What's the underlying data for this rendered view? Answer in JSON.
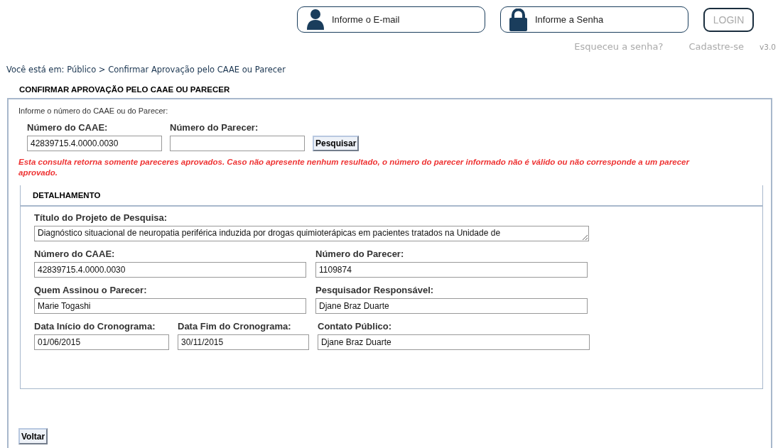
{
  "header": {
    "email": {
      "placeholder": "Informe o E-mail"
    },
    "password": {
      "placeholder": "Informe a Senha"
    },
    "login_button": "LOGIN",
    "links": [
      "Esqueceu a senha?",
      "Cadastre-se"
    ],
    "version": "v3.0"
  },
  "breadcrumb": "Você está em: Público > Confirmar Aprovação pelo CAAE ou Parecer",
  "section_title": "CONFIRMAR APROVAÇÃO PELO CAAE OU PARECER",
  "search": {
    "instruction": "Informe o número do CAAE ou do Parecer:",
    "fields": [
      {
        "label": "Número do CAAE:",
        "value": "42839715.4.0000.0030"
      },
      {
        "label": "Número do Parecer:"
      }
    ],
    "button": "Pesquisar",
    "warning": "Esta consulta retorna somente pareceres aprovados. Caso não apresente nenhum resultado, o número do parecer informado não é válido ou não corresponde a um parecer aprovado."
  },
  "detail": {
    "title": "DETALHAMENTO",
    "rows": [
      {
        "kind": "single",
        "fields": [
          {
            "kind": "textarea",
            "label": "Título do Projeto de Pesquisa:",
            "value": "Diagnóstico situacional de neuropatia periférica induzida por drogas quimioterápicas em pacientes tratados na Unidade de"
          }
        ]
      },
      {
        "kind": "pair",
        "fields": [
          {
            "kind": "input",
            "label": "Número do CAAE:",
            "value": "42839715.4.0000.0030"
          },
          {
            "kind": "input",
            "label": "Número do Parecer:",
            "value": "1109874"
          }
        ]
      },
      {
        "kind": "pair",
        "fields": [
          {
            "kind": "input",
            "label": "Quem Assinou o Parecer:",
            "value": "Marie Togashi"
          },
          {
            "kind": "input",
            "label": "Pesquisador Responsável:",
            "value": "Djane Braz Duarte"
          }
        ]
      },
      {
        "kind": "triple",
        "fields": [
          {
            "kind": "input",
            "label": "Data Início do Cronograma:",
            "value": "01/06/2015"
          },
          {
            "kind": "input",
            "label": "Data Fim do Cronograma:",
            "value": "30/11/2015"
          },
          {
            "kind": "input",
            "label": "Contato Público:",
            "value": "Djane Braz Duarte"
          }
        ]
      }
    ]
  },
  "back_button": "Voltar"
}
